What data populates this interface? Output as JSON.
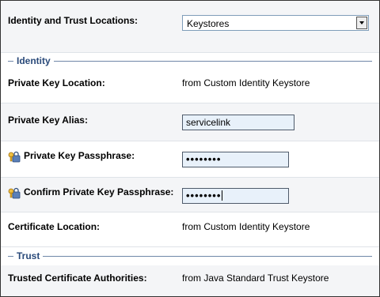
{
  "identity_and_trust": {
    "label": "Identity and Trust Locations:",
    "selected": "Keystores"
  },
  "identity_section": {
    "title": "Identity",
    "private_key_location": {
      "label": "Private Key Location:",
      "value": "from Custom Identity Keystore"
    },
    "private_key_alias": {
      "label": "Private Key Alias:",
      "value": "servicelink"
    },
    "private_key_passphrase": {
      "label": "Private Key Passphrase:",
      "value": "••••••••"
    },
    "confirm_passphrase": {
      "label": "Confirm Private Key Passphrase:",
      "value": "••••••••"
    },
    "certificate_location": {
      "label": "Certificate Location:",
      "value": "from Custom Identity Keystore"
    }
  },
  "trust_section": {
    "title": "Trust",
    "trusted_cas": {
      "label": "Trusted Certificate Authorities:",
      "value": "from Java Standard Trust Keystore"
    }
  },
  "icons": {
    "passphrase_row_icon": "key-lock-icon"
  },
  "colors": {
    "accent": "#2a4a7a",
    "input_bg": "#e8f1fa",
    "row_alt": "#f4f5f7"
  }
}
